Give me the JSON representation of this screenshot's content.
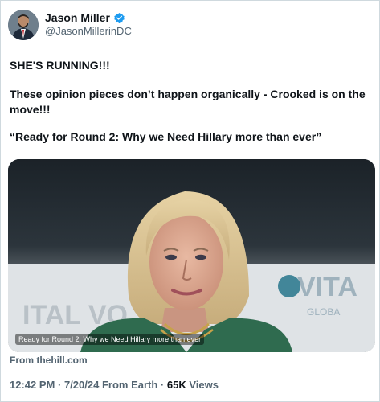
{
  "author": {
    "name": "Jason Miller",
    "handle": "@JasonMillerinDC",
    "verified_color": "#1d9bf0"
  },
  "tweet": {
    "line1": "SHE'S RUNNING!!!",
    "line2": "These opinion pieces don’t happen organically - Crooked is on the",
    "line3": "move!!!",
    "line4": "“Ready for Round 2: Why we Need Hillary more than ever”"
  },
  "card": {
    "caption": "Ready for Round 2: Why we Need Hillary more than ever",
    "source": "From thehill.com",
    "bg_text_left": "ITAL VO",
    "bg_text_right_1": "VITA",
    "bg_text_right_2": "GLOBA"
  },
  "meta": {
    "time": "12:42 PM",
    "date": "7/20/24",
    "location": "From Earth",
    "views_count": "65K",
    "views_label": "Views"
  }
}
